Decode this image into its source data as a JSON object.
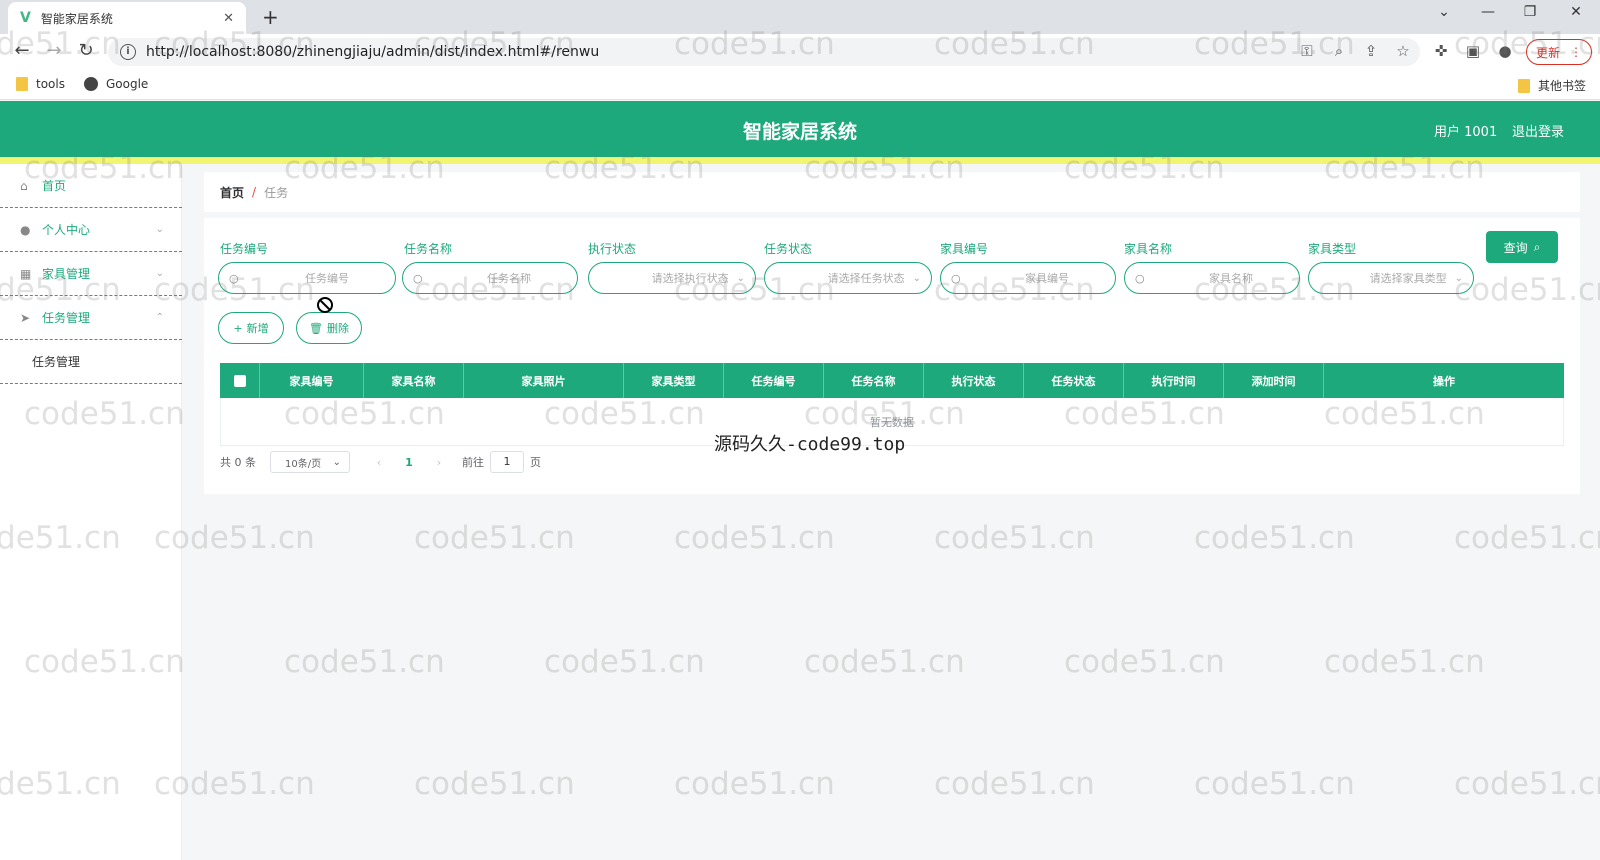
{
  "browser": {
    "tab_title": "智能家居系统",
    "url": "http://localhost:8080/zhinengjiaju/admin/dist/index.html#/renwu",
    "update_label": "更新",
    "bookmarks": [
      {
        "label": "tools"
      },
      {
        "label": "Google"
      }
    ],
    "other_bookmarks": "其他书签"
  },
  "header": {
    "title": "智能家居系统",
    "user": "用户 1001",
    "logout": "退出登录"
  },
  "sidebar": {
    "items": [
      {
        "label": "首页"
      },
      {
        "label": "个人中心"
      },
      {
        "label": "家具管理"
      },
      {
        "label": "任务管理"
      }
    ],
    "sub_item": "任务管理"
  },
  "breadcrumb": {
    "home": "首页",
    "separator": "/",
    "current": "任务"
  },
  "filters": [
    {
      "label": "任务编号",
      "placeholder": "任务编号"
    },
    {
      "label": "任务名称",
      "placeholder": "任务名称"
    },
    {
      "label": "执行状态",
      "placeholder": "请选择执行状态"
    },
    {
      "label": "任务状态",
      "placeholder": "请选择任务状态"
    },
    {
      "label": "家具编号",
      "placeholder": "家具编号"
    },
    {
      "label": "家具名称",
      "placeholder": "家具名称"
    },
    {
      "label": "家具类型",
      "placeholder": "请选择家具类型"
    }
  ],
  "buttons": {
    "query": "查询",
    "add": "新增",
    "delete": "删除"
  },
  "table": {
    "columns": [
      "家具编号",
      "家具名称",
      "家具照片",
      "家具类型",
      "任务编号",
      "任务名称",
      "执行状态",
      "任务状态",
      "执行时间",
      "添加时间",
      "操作"
    ],
    "empty_text": "暂无数据"
  },
  "pagination": {
    "total": "共 0 条",
    "page_size": "10条/页",
    "current_page": "1",
    "goto_label": "前往",
    "goto_value": "1",
    "page_suffix": "页"
  },
  "site_watermark": "源码久久-code99.top",
  "watermark_text": "code51.cn",
  "colors": {
    "primary": "#1ea97c",
    "stripe": "#f2f570"
  }
}
